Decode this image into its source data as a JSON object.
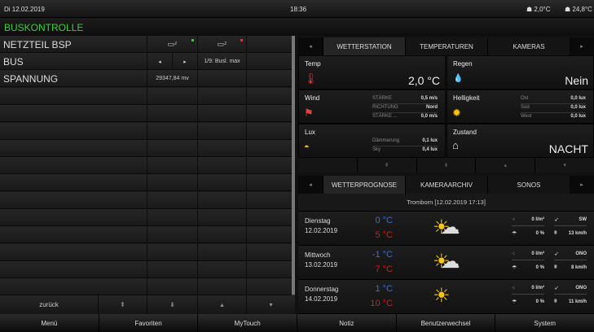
{
  "topbar": {
    "date": "Di  12.02.2019",
    "time": "18:36",
    "outdoor_temp": "2,0°C",
    "indoor_temp": "24,8°C"
  },
  "title": "BUSKONTROLLE",
  "left": {
    "rows": [
      {
        "name": "NETZTEIL BSP"
      },
      {
        "name": "BUS",
        "status": "1/9: Busl. max"
      },
      {
        "name": "SPANNUNG",
        "value": "29347,84 mv"
      }
    ],
    "bottom": {
      "back": "zurück"
    }
  },
  "colors": {
    "title": "#3bd13b",
    "led_ok": "#2ecc2e",
    "led_err": "#e03030",
    "temp_min": "#2d6df0",
    "temp_max": "#e01818"
  },
  "tabs1": [
    "WETTERSTATION",
    "TEMPERATUREN",
    "KAMERAS"
  ],
  "station": {
    "temp": {
      "label": "Temp",
      "value": "2,0 °C"
    },
    "regen": {
      "label": "Regen",
      "value": "Nein"
    },
    "wind": {
      "label": "Wind",
      "rows": [
        {
          "k": "STÄRKE",
          "v": "0,5 m/s"
        },
        {
          "k": "RICHTUNG",
          "v": "Nord"
        },
        {
          "k": "STÄRKE ...",
          "v": "0,0 m/s"
        }
      ]
    },
    "hell": {
      "label": "Helligkeit",
      "rows": [
        {
          "k": "Ost",
          "v": "0,0 lux"
        },
        {
          "k": "Süd",
          "v": "0,0 lux"
        },
        {
          "k": "West",
          "v": "0,0 lux"
        }
      ]
    },
    "lux": {
      "label": "Lux",
      "rows": [
        {
          "k": "Dämmerung",
          "v": "0,1 lux"
        },
        {
          "k": "Sky",
          "v": "0,4 lux"
        }
      ]
    },
    "zustand": {
      "label": "Zustand",
      "value": "NACHT"
    }
  },
  "tabs2": [
    "WETTERPROGNOSE",
    "KAMERAARCHIV",
    "SONOS"
  ],
  "forecast": {
    "location": "Tromborn  [12.02.2019 17:13]",
    "days": [
      {
        "day": "Dienstag",
        "date": "12.02.2019",
        "min": "0 °C",
        "max": "5 °C",
        "rain": "0 l/m²",
        "prob": "0 %",
        "dir": "SW",
        "wind": "13 km/h",
        "icon": "partly-cloudy"
      },
      {
        "day": "Mittwoch",
        "date": "13.02.2019",
        "min": "-1 °C",
        "max": "7 °C",
        "rain": "0 l/m²",
        "prob": "0 %",
        "dir": "ONO",
        "wind": "8 km/h",
        "icon": "partly-cloudy"
      },
      {
        "day": "Donnerstag",
        "date": "14.02.2019",
        "min": "1 °C",
        "max": "10 °C",
        "rain": "0 l/m²",
        "prob": "0 %",
        "dir": "ONO",
        "wind": "11 km/h",
        "icon": "sunny"
      }
    ]
  },
  "footer": [
    "Menü",
    "Favoriten",
    "MyTouch",
    "Notiz",
    "Benutzerwechsel",
    "System"
  ]
}
